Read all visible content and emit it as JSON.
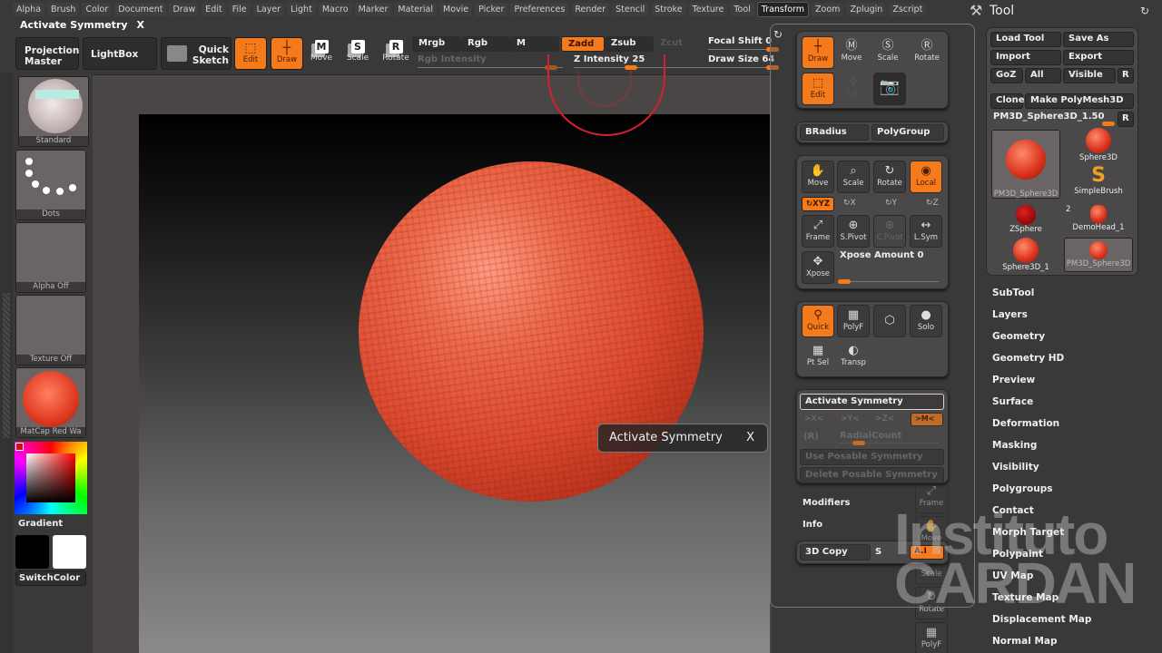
{
  "menu": [
    "Alpha",
    "Brush",
    "Color",
    "Document",
    "Draw",
    "Edit",
    "File",
    "Layer",
    "Light",
    "Macro",
    "Marker",
    "Material",
    "Movie",
    "Picker",
    "Preferences",
    "Render",
    "Stencil",
    "Stroke",
    "Texture",
    "Tool",
    "Transform",
    "Zoom",
    "Zplugin",
    "Zscript"
  ],
  "active_menu": "Transform",
  "title": {
    "text": "Activate Symmetry",
    "close": "X"
  },
  "shelf": {
    "projection_master": "Projection Master",
    "lightbox": "LightBox",
    "quick_sketch": "Quick Sketch",
    "edit": "Edit",
    "draw": "Draw",
    "move": {
      "label": "Move",
      "key": "M"
    },
    "scale": {
      "label": "Scale",
      "key": "S"
    },
    "rotate": {
      "label": "Rotate",
      "key": "R"
    },
    "mrgb": "Mrgb",
    "rgb": "Rgb",
    "m": "M",
    "zadd": "Zadd",
    "zsub": "Zsub",
    "zcut": "Zcut",
    "rgb_intensity": "Rgb Intensity",
    "z_intensity": "Z Intensity 25",
    "focal_shift": "Focal Shift 0",
    "draw_size": "Draw Size 64",
    "z_intensity_value": 25,
    "focal_shift_value": 0,
    "draw_size_value": 64
  },
  "left": {
    "brush": "Standard",
    "stroke": "Dots",
    "alpha": "Alpha Off",
    "texture": "Texture Off",
    "material": "MatCap Red Wa",
    "gradient": "Gradient",
    "switch_color": "SwitchColor",
    "main_color": "#d01010",
    "swatch_primary": "#000000",
    "swatch_secondary": "#ffffff"
  },
  "tooltip": {
    "text": "Activate Symmetry",
    "close": "X"
  },
  "transform_panel": {
    "draw": "Draw",
    "move": "Move",
    "scale": "Scale",
    "rotate": "Rotate",
    "edit": "Edit",
    "edit_dim": "Edit",
    "snapshot": "camera",
    "bradius": "BRadius",
    "polygroup": "PolyGroup",
    "move2": "Move",
    "scale2": "Scale",
    "rotate2": "Rotate",
    "local": "Local",
    "xyz": "XYZ",
    "x": "X",
    "y": "Y",
    "z": "Z",
    "frame": "Frame",
    "spivot": "S.Pivot",
    "cpivot": "C.Pivot",
    "lsym": "L.Sym",
    "xpose": "Xpose",
    "xpose_amount": "Xpose Amount 0",
    "xpose_amount_value": 0,
    "quick": "Quick",
    "polyf": "PolyF",
    "solo": "Solo",
    "ptsel": "Pt Sel",
    "transp": "Transp",
    "activate_symmetry": "Activate Symmetry",
    "sym_x": ">X<",
    "sym_y": ">Y<",
    "sym_z": ">Z<",
    "sym_m": ">M<",
    "radial": "(R)",
    "radial_count": "RadialCount",
    "use_posable": "Use Posable Symmetry",
    "delete_posable": "Delete Posable Symmetry",
    "modifiers": "Modifiers",
    "info": "Info",
    "copy3d": "3D Copy",
    "s": "S",
    "ai": "A.I"
  },
  "side_strip": [
    "Frame",
    "Move",
    "Scale",
    "Rotate",
    "PolyF"
  ],
  "tool_panel": {
    "title": "Tool",
    "load_tool": "Load Tool",
    "save_as": "Save As",
    "import": "Import",
    "export": "Export",
    "goz": "GoZ",
    "all": "All",
    "visible": "Visible",
    "r": "R",
    "clone": "Clone",
    "make_polymesh": "Make PolyMesh3D",
    "current_tool": "PM3D_Sphere3D_1.50",
    "thumbs": [
      {
        "name": "PM3D_Sphere3D",
        "selected": true
      },
      {
        "name": "Sphere3D"
      },
      {
        "name": "SimpleBrush"
      },
      {
        "name": "ZSphere"
      },
      {
        "name": "DemoHead_1",
        "badge": "2"
      },
      {
        "name": "Sphere3D_1"
      },
      {
        "name": "PM3D_Sphere3D",
        "selected": true
      }
    ],
    "subpalettes": [
      "SubTool",
      "Layers",
      "Geometry",
      "Geometry HD",
      "Preview",
      "Surface",
      "Deformation",
      "Masking",
      "Visibility",
      "Polygroups",
      "Contact",
      "Morph Target",
      "Polypaint",
      "UV Map",
      "Texture Map",
      "Displacement Map",
      "Normal Map"
    ]
  },
  "watermark": {
    "line1": "Instituto",
    "line2": "CARDAN"
  },
  "accent": "#f47a1c"
}
